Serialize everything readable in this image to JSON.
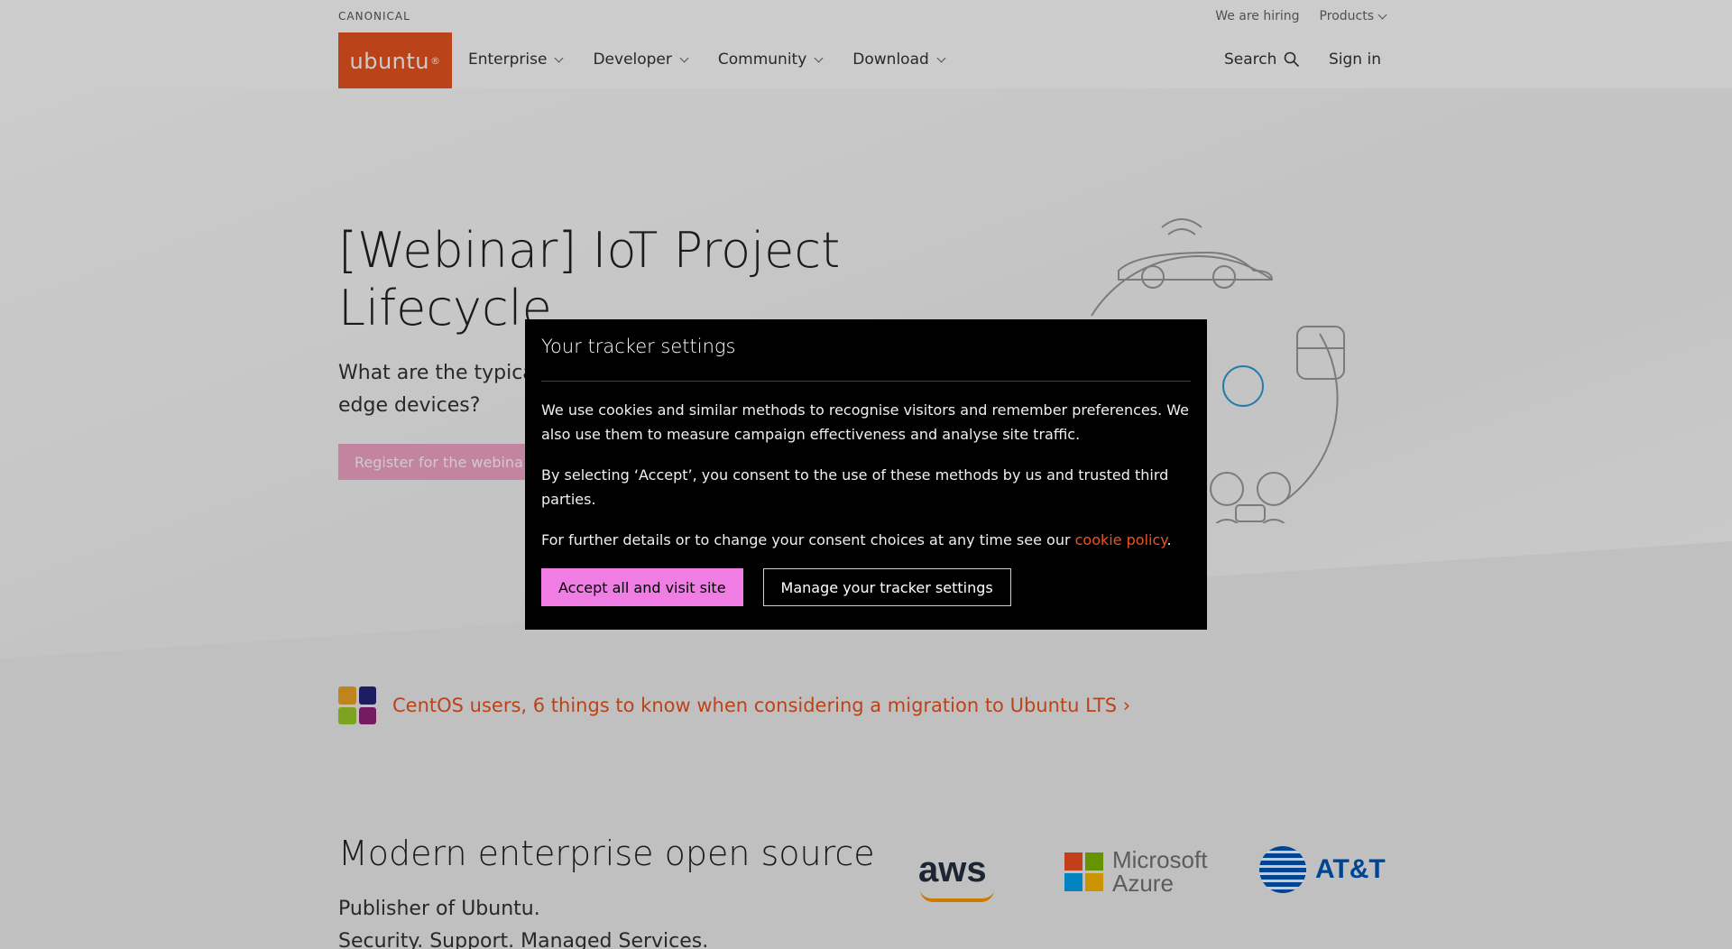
{
  "header": {
    "canonical_label": "CANONICAL",
    "meta_links": [
      "We are hiring",
      "Products"
    ],
    "logo_text": "ubuntu",
    "logo_mark": "®",
    "nav": [
      {
        "label": "Enterprise"
      },
      {
        "label": "Developer"
      },
      {
        "label": "Community"
      },
      {
        "label": "Download"
      }
    ],
    "search_label": "Search",
    "signin_label": "Sign in"
  },
  "hero": {
    "title": "[Webinar] IoT Project Lifecycle",
    "subtitle_visible": "What are the typica",
    "subtitle_line2": "edge devices?",
    "cta_visible": "Register for the webina"
  },
  "promo": {
    "text": "CentOS users, 6 things to know when considering a migration to Ubuntu LTS ›"
  },
  "enterprise": {
    "title": "Modern enterprise open source",
    "subtitle_lines": [
      "Publisher of Ubuntu.",
      "Security. Support. Managed Services."
    ],
    "partners": {
      "aws": "aws",
      "azure_line1": "Microsoft",
      "azure_line2": "Azure",
      "att": "AT&T"
    }
  },
  "modal": {
    "title": "Your tracker settings",
    "para1": "We use cookies and similar methods to recognise visitors and remember preferences. We also use them to measure campaign effectiveness and analyse site traffic.",
    "para2": "By selecting ‘Accept’, you consent to the use of these methods by us and trusted third parties.",
    "para3_prefix": "For further details or to change your consent choices at any time see our ",
    "para3_link": "cookie policy",
    "para3_suffix": ".",
    "accept_label": "Accept all and visit site",
    "manage_label": "Manage your tracker settings"
  },
  "colors": {
    "ubuntu_orange": "#e95420",
    "accept_pink": "#ef7de3",
    "modal_bg": "#000000"
  }
}
